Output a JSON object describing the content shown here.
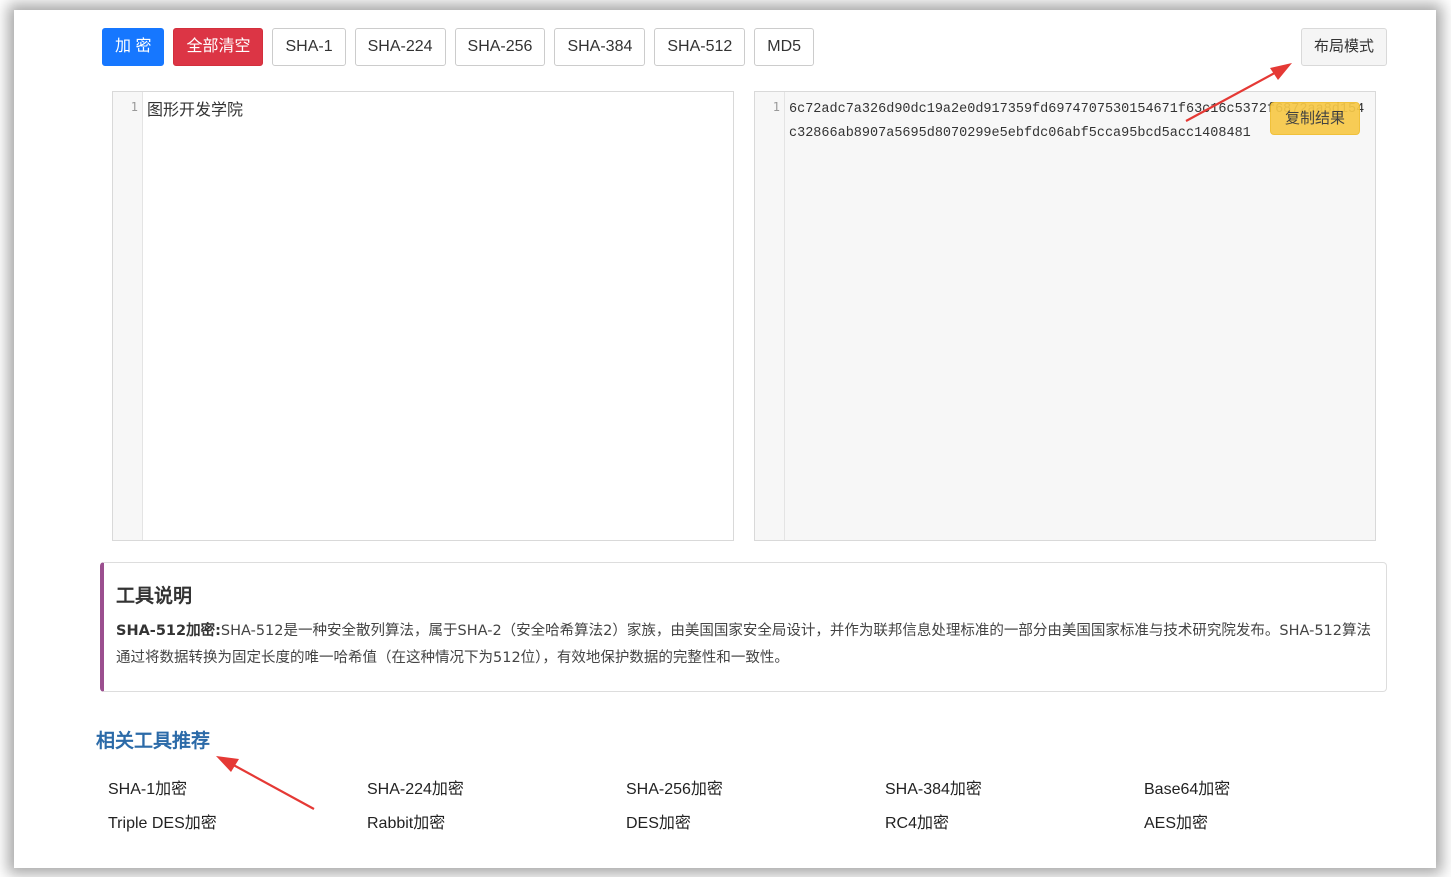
{
  "toolbar": {
    "encrypt_label": "加 密",
    "clear_label": "全部清空",
    "algorithms": [
      "SHA-1",
      "SHA-224",
      "SHA-256",
      "SHA-384",
      "SHA-512",
      "MD5"
    ],
    "layout_label": "布局模式"
  },
  "input_editor": {
    "line_number": "1",
    "text": "图形开发学院"
  },
  "output_editor": {
    "line_number": "1",
    "text": "6c72adc7a326d90dc19a2e0d917359fd6974707530154671f63c16c5372f6872aa8d154c32866ab8907a5695d8070299e5ebfdc06abf5cca95bcd5acc1408481",
    "copy_label": "复制结果"
  },
  "description": {
    "title": "工具说明",
    "bold_prefix": "SHA-512加密:",
    "body": "SHA-512是一种安全散列算法，属于SHA-2（安全哈希算法2）家族，由美国国家安全局设计，并作为联邦信息处理标准的一部分由美国国家标准与技术研究院发布。SHA-512算法通过将数据转换为固定长度的唯一哈希值（在这种情况下为512位），有效地保护数据的完整性和一致性。"
  },
  "related": {
    "title": "相关工具推荐",
    "items": [
      "SHA-1加密",
      "SHA-224加密",
      "SHA-256加密",
      "SHA-384加密",
      "Base64加密",
      "Triple DES加密",
      "Rabbit加密",
      "DES加密",
      "RC4加密",
      "AES加密"
    ]
  },
  "colors": {
    "primary": "#1677ff",
    "danger": "#dc3545",
    "warning": "#f7c948",
    "accent_border": "#9b4f8f",
    "link_title": "#2b6aa8",
    "annotation_arrow": "#e53935"
  }
}
